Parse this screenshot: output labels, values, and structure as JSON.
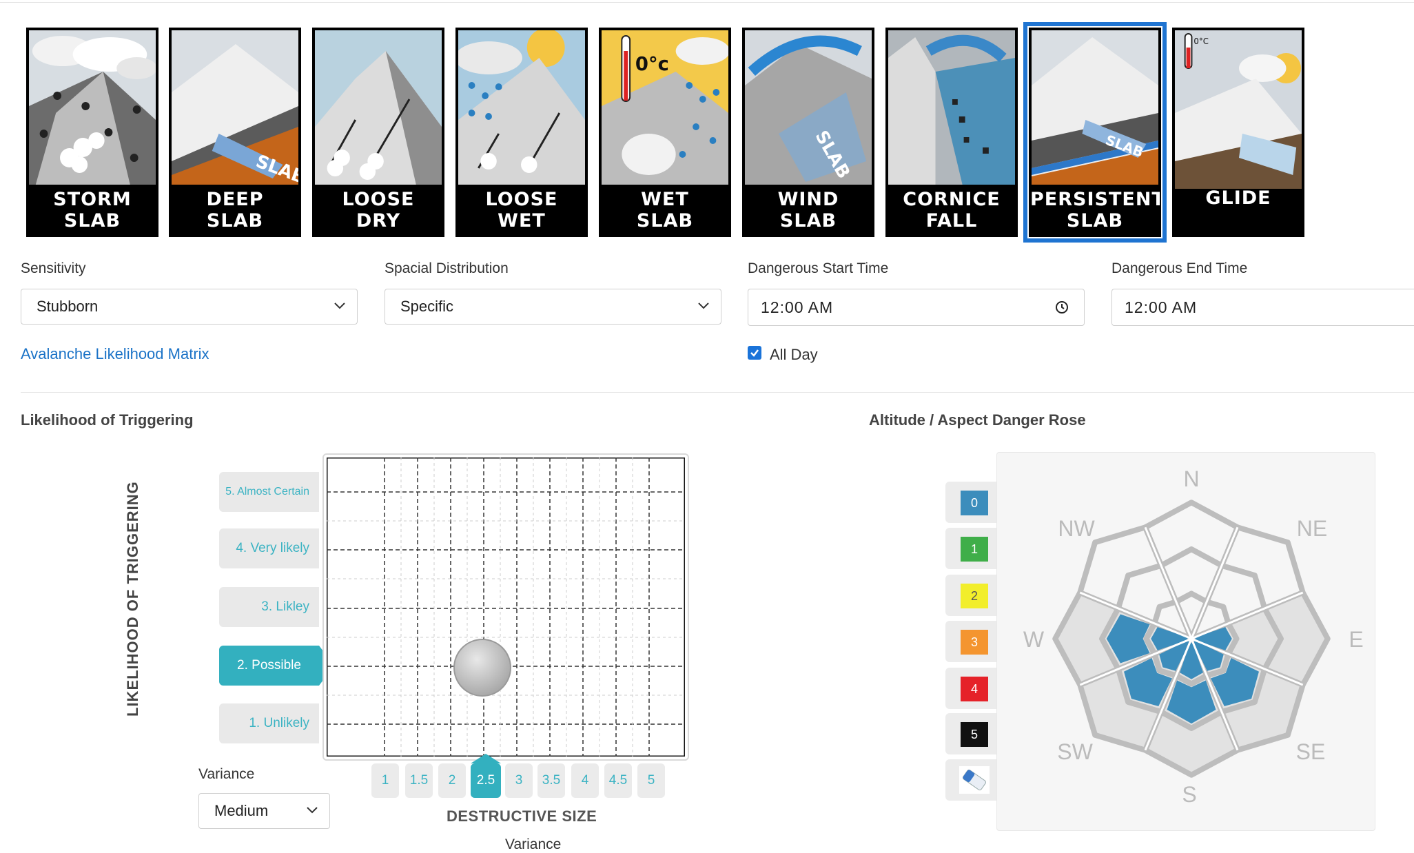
{
  "problem_types": [
    {
      "line1": "STORM",
      "line2": "SLAB",
      "selected": false
    },
    {
      "line1": "DEEP",
      "line2": "SLAB",
      "selected": false
    },
    {
      "line1": "LOOSE",
      "line2": "DRY",
      "selected": false
    },
    {
      "line1": "LOOSE",
      "line2": "WET",
      "selected": false
    },
    {
      "line1": "WET",
      "line2": "SLAB",
      "selected": false
    },
    {
      "line1": "WIND",
      "line2": "SLAB",
      "selected": false
    },
    {
      "line1": "CORNICE",
      "line2": "FALL",
      "selected": false
    },
    {
      "line1": "PERSISTENT",
      "line2": "SLAB",
      "selected": true
    },
    {
      "line1": "GLIDE",
      "line2": "",
      "selected": false
    }
  ],
  "tile_art_text": {
    "slab": "SLAB",
    "temp": "0°c",
    "temp_small": "0°C"
  },
  "form": {
    "sensitivity": {
      "label": "Sensitivity",
      "value": "Stubborn"
    },
    "spatial": {
      "label": "Spacial Distribution",
      "value": "Specific"
    },
    "start": {
      "label": "Dangerous Start Time",
      "value": "12:00 AM"
    },
    "end": {
      "label": "Dangerous End Time",
      "value": "12:00 AM"
    },
    "matrix_link": "Avalanche Likelihood Matrix",
    "all_day": {
      "label": "All Day",
      "checked": true
    }
  },
  "likelihood": {
    "title": "Likelihood of Triggering",
    "axis_label": "LIKELIHOOD OF TRIGGERING",
    "levels": [
      "5. Almost Certain",
      "4. Very likely",
      "3. Likley",
      "2. Possible",
      "1. Unlikely"
    ],
    "selected_level": "2. Possible",
    "variance_label": "Variance",
    "variance_value": "Medium",
    "size_axis_label": "DESTRUCTIVE SIZE",
    "sizes": [
      "1",
      "1.5",
      "2",
      "2.5",
      "3",
      "3.5",
      "4",
      "4.5",
      "5"
    ],
    "selected_size": "2.5",
    "size_variance_label": "Variance"
  },
  "rose": {
    "title": "Altitude / Aspect Danger Rose",
    "directions": [
      "N",
      "NE",
      "E",
      "SE",
      "S",
      "SW",
      "W",
      "NW"
    ],
    "levels": [
      {
        "label": "0",
        "color": "#3c8dbc",
        "text": "#ffffff"
      },
      {
        "label": "1",
        "color": "#3fae49",
        "text": "#ffffff"
      },
      {
        "label": "2",
        "color": "#f2ee2b",
        "text": "#555555"
      },
      {
        "label": "3",
        "color": "#f4952f",
        "text": "#ffffff"
      },
      {
        "label": "4",
        "color": "#e52229",
        "text": "#ffffff"
      },
      {
        "label": "5",
        "color": "#111111",
        "text": "#ffffff"
      }
    ],
    "eraser_icon": "eraser-icon",
    "highlight_color": "#3c8dbc"
  }
}
